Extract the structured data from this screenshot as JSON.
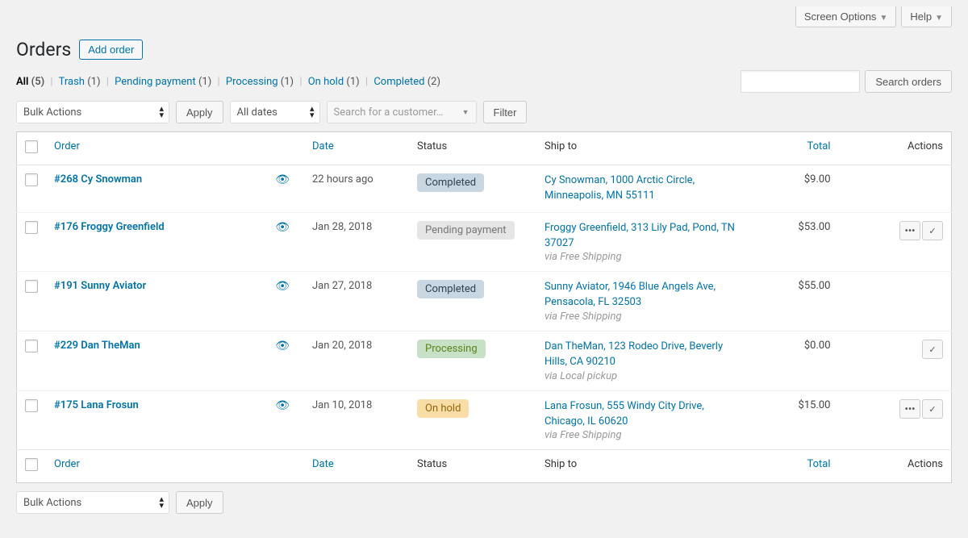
{
  "topbar": {
    "screen_options": "Screen Options",
    "help": "Help"
  },
  "header": {
    "title": "Orders",
    "add_btn": "Add order"
  },
  "filters": {
    "all_label": "All",
    "all_count": "(5)",
    "links": [
      {
        "label": "Trash",
        "count": "(1)"
      },
      {
        "label": "Pending payment",
        "count": "(1)"
      },
      {
        "label": "Processing",
        "count": "(1)"
      },
      {
        "label": "On hold",
        "count": "(1)"
      },
      {
        "label": "Completed",
        "count": "(2)"
      }
    ],
    "search_btn": "Search orders"
  },
  "tablenav": {
    "bulk_label": "Bulk Actions",
    "apply": "Apply",
    "dates_label": "All dates",
    "customer_placeholder": "Search for a customer…",
    "filter": "Filter"
  },
  "columns": {
    "order": "Order",
    "date": "Date",
    "status": "Status",
    "ship": "Ship to",
    "total": "Total",
    "actions": "Actions"
  },
  "rows": [
    {
      "order": "#268 Cy Snowman",
      "date": "22 hours ago",
      "status": "Completed",
      "status_class": "status-completed",
      "ship": "Cy Snowman, 1000 Arctic Circle, Minneapolis, MN 55111",
      "via": "",
      "total": "$9.00",
      "show_more": false,
      "show_complete": false
    },
    {
      "order": "#176 Froggy Greenfield",
      "date": "Jan 28, 2018",
      "status": "Pending payment",
      "status_class": "status-pending",
      "ship": "Froggy Greenfield, 313 Lily Pad, Pond, TN 37027",
      "via": "via Free Shipping",
      "total": "$53.00",
      "show_more": true,
      "show_complete": true
    },
    {
      "order": "#191 Sunny Aviator",
      "date": "Jan 27, 2018",
      "status": "Completed",
      "status_class": "status-completed",
      "ship": "Sunny Aviator, 1946 Blue Angels Ave, Pensacola, FL 32503",
      "via": "via Free Shipping",
      "total": "$55.00",
      "show_more": false,
      "show_complete": false
    },
    {
      "order": "#229 Dan TheMan",
      "date": "Jan 20, 2018",
      "status": "Processing",
      "status_class": "status-processing",
      "ship": "Dan TheMan, 123 Rodeo Drive, Beverly Hills, CA 90210",
      "via": "via Local pickup",
      "total": "$0.00",
      "show_more": false,
      "show_complete": true
    },
    {
      "order": "#175 Lana Frosun",
      "date": "Jan 10, 2018",
      "status": "On hold",
      "status_class": "status-onhold",
      "ship": "Lana Frosun, 555 Windy City Drive, Chicago, IL 60620",
      "via": "via Free Shipping",
      "total": "$15.00",
      "show_more": true,
      "show_complete": true
    }
  ]
}
